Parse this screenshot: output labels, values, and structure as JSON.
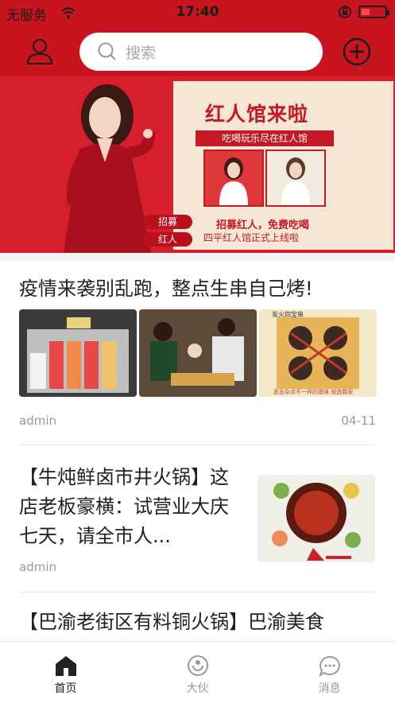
{
  "status_bar": {
    "carrier": "无服务",
    "time": "17:40",
    "battery_level": 0.35
  },
  "header": {
    "search_placeholder": "搜索"
  },
  "banner": {
    "title": "红人馆来啦",
    "slogan": "吃喝玩乐尽在红人馆",
    "recruit_text": "招募红人，免费吃喝",
    "location_text": "四平红人馆正式上线啦",
    "tags": [
      "招募",
      "红人"
    ]
  },
  "articles": [
    {
      "title": "疫情来袭别乱跑，整点生串自己烤!",
      "author": "admin",
      "date": "04-11",
      "images": [
        {
          "sign": "",
          "stamp": ""
        },
        {
          "sign": "",
          "stamp": ""
        },
        {
          "sign": "炭火四宝串",
          "stamp": "逃去杂点不一样的滋味 就选我家"
        }
      ]
    },
    {
      "title": "【牛炖鲜卤市井火锅】这店老板豪横：试营业大庆七天，请全市人...",
      "author": "admin"
    },
    {
      "title": "【巴渝老街区有料铜火锅】巴渝美食"
    }
  ],
  "tabbar": {
    "active_color": "#222222",
    "inactive_color": "#9a9a9a",
    "items": [
      {
        "label": "首页",
        "icon": "home-icon",
        "active": true
      },
      {
        "label": "大伙",
        "icon": "people-icon",
        "active": false
      },
      {
        "label": "消息",
        "icon": "message-icon",
        "active": false
      }
    ]
  }
}
